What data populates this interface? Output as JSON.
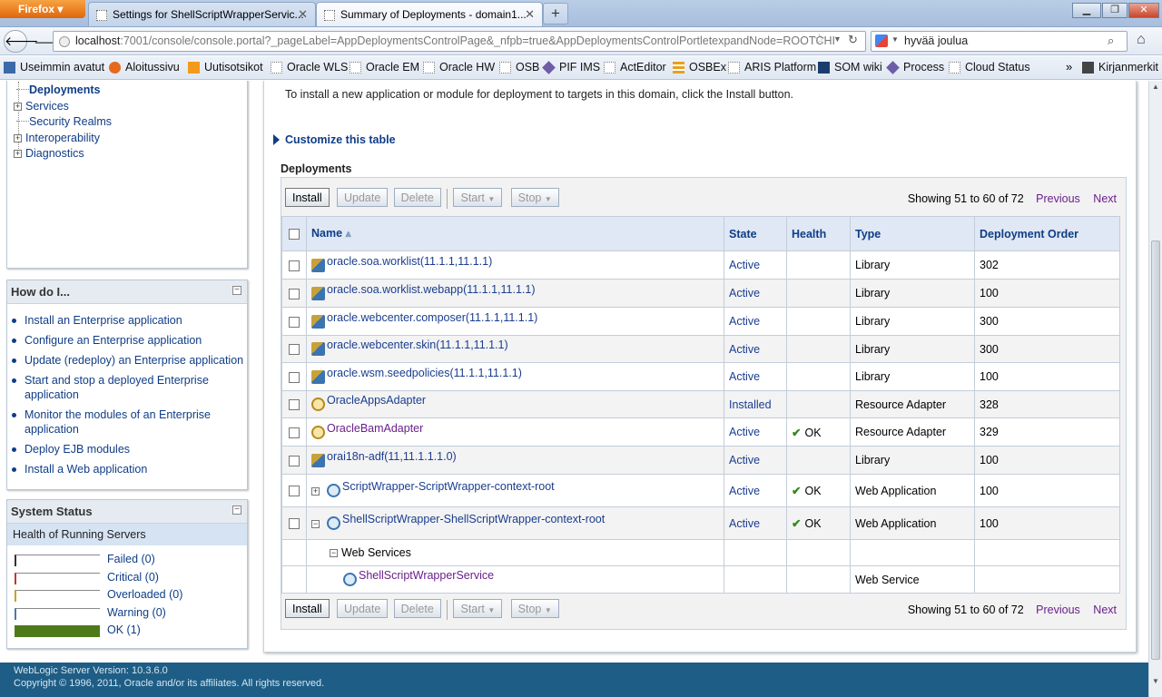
{
  "browser": {
    "menu_button": "Firefox",
    "tabs": [
      {
        "title": "Settings for ShellScriptWrapperServic...",
        "active": false
      },
      {
        "title": "Summary of Deployments - domain1...",
        "active": true
      }
    ],
    "new_tab": "+",
    "url_host": "localhost",
    "url_rest": ":7001/console/console.portal?_pageLabel=AppDeploymentsControlPage&_nfpb=true&AppDeploymentsControlPortletexpandNode=ROOTCHI",
    "search_value": "hyvää joulua",
    "bookmarks": [
      "Useimmin avatut",
      "Aloitussivu",
      "Uutisotsikot",
      "Oracle WLS",
      "Oracle EM",
      "Oracle HW",
      "OSB",
      "PIF IMS",
      "ActEditor",
      "OSBEx",
      "ARIS Platform",
      "SOM wiki",
      "Process",
      "Cloud Status"
    ],
    "bookmarks_more": "»",
    "bookmarks_menu": "Kirjanmerkit"
  },
  "tree": {
    "items": [
      {
        "label": "Deployments",
        "selected": true,
        "expandable": false
      },
      {
        "label": "Services",
        "expandable": true
      },
      {
        "label": "Security Realms",
        "expandable": false
      },
      {
        "label": "Interoperability",
        "expandable": true
      },
      {
        "label": "Diagnostics",
        "expandable": true
      }
    ]
  },
  "howdoi": {
    "title": "How do I...",
    "links": [
      "Install an Enterprise application",
      "Configure an Enterprise application",
      "Update (redeploy) an Enterprise application",
      "Start and stop a deployed Enterprise application",
      "Monitor the modules of an Enterprise application",
      "Deploy EJB modules",
      "Install a Web application"
    ]
  },
  "system_status": {
    "title": "System Status",
    "subtitle": "Health of Running Servers",
    "rows": [
      {
        "label": "Failed (0)",
        "color": "#333333",
        "fill": 0
      },
      {
        "label": "Critical (0)",
        "color": "#c0392b",
        "fill": 0
      },
      {
        "label": "Overloaded (0)",
        "color": "#c9a227",
        "fill": 0
      },
      {
        "label": "Warning (0)",
        "color": "#4a78b5",
        "fill": 0
      },
      {
        "label": "OK (1)",
        "color": "#4f7a1a",
        "fill": 1
      }
    ]
  },
  "main": {
    "intro": "To install a new application or module for deployment to targets in this domain, click the Install button.",
    "customize": "Customize this table",
    "section_title": "Deployments",
    "buttons": {
      "install": "Install",
      "update": "Update",
      "delete": "Delete",
      "start": "Start",
      "stop": "Stop"
    },
    "paging": {
      "showing": "Showing 51 to 60 of 72",
      "previous": "Previous",
      "next": "Next"
    },
    "columns": {
      "name": "Name",
      "state": "State",
      "health": "Health",
      "type": "Type",
      "order": "Deployment Order"
    },
    "rows": [
      {
        "name": "oracle.soa.worklist(11.1.1,11.1.1)",
        "state": "Active",
        "health": "",
        "type": "Library",
        "order": "302"
      },
      {
        "name": "oracle.soa.worklist.webapp(11.1.1,11.1.1)",
        "state": "Active",
        "health": "",
        "type": "Library",
        "order": "100"
      },
      {
        "name": "oracle.webcenter.composer(11.1.1,11.1.1)",
        "state": "Active",
        "health": "",
        "type": "Library",
        "order": "300"
      },
      {
        "name": "oracle.webcenter.skin(11.1.1,11.1.1)",
        "state": "Active",
        "health": "",
        "type": "Library",
        "order": "300"
      },
      {
        "name": "oracle.wsm.seedpolicies(11.1.1,11.1.1)",
        "state": "Active",
        "health": "",
        "type": "Library",
        "order": "100"
      },
      {
        "name": "OracleAppsAdapter",
        "state": "Installed",
        "health": "",
        "type": "Resource Adapter",
        "order": "328"
      },
      {
        "name": "OracleBamAdapter",
        "state": "Active",
        "health": "OK",
        "type": "Resource Adapter",
        "order": "329"
      },
      {
        "name": "orai18n-adf(11,11.1.1.1.0)",
        "state": "Active",
        "health": "",
        "type": "Library",
        "order": "100"
      },
      {
        "name": "ScriptWrapper-ScriptWrapper-context-root",
        "state": "Active",
        "health": "OK",
        "type": "Web Application",
        "order": "100"
      },
      {
        "name": "ShellScriptWrapper-ShellScriptWrapper-context-root",
        "state": "Active",
        "health": "OK",
        "type": "Web Application",
        "order": "100"
      }
    ],
    "web_services_label": "Web Services",
    "ws_row": {
      "name": "ShellScriptWrapperService",
      "type": "Web Service"
    }
  },
  "footer": {
    "version": "WebLogic Server Version: 10.3.6.0",
    "copyright": "Copyright © 1996, 2011, Oracle and/or its affiliates. All rights reserved."
  }
}
